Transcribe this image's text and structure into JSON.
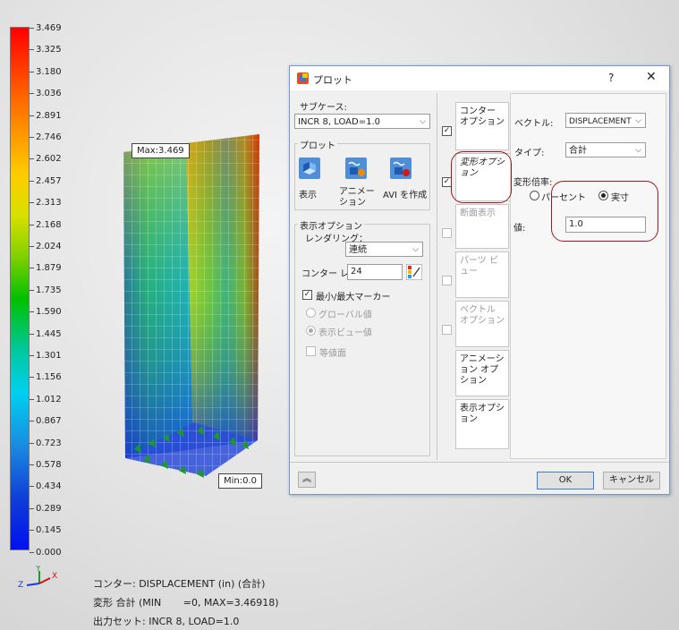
{
  "legend": {
    "values": [
      "3.469",
      "3.325",
      "3.180",
      "3.036",
      "2.891",
      "2.746",
      "2.602",
      "2.457",
      "2.313",
      "2.168",
      "2.024",
      "1.879",
      "1.735",
      "1.590",
      "1.445",
      "1.301",
      "1.156",
      "1.012",
      "0.867",
      "0.723",
      "0.578",
      "0.434",
      "0.289",
      "0.145",
      "0.000"
    ]
  },
  "markers": {
    "max": "Max:3.469",
    "min": "Min:0.0"
  },
  "axis": {
    "z": "Z",
    "y": "Y",
    "x": "X"
  },
  "info": {
    "line1": "コンター: DISPLACEMENT (in) (合計)",
    "line2": "変形 合計 (MIN       =0, MAX=3.46918)",
    "line3": "出力セット: INCR 8, LOAD=1.0"
  },
  "dialog": {
    "title": "プロット",
    "help": "?",
    "close": "✕",
    "subcase_label": "サブケース:",
    "subcase_value": "INCR 8, LOAD=1.0",
    "plot_group": "プロット",
    "tools": [
      {
        "label": "表示",
        "icon": "display-icon"
      },
      {
        "label": "アニメーション",
        "icon": "animation-icon"
      },
      {
        "label": "AVI を作成",
        "icon": "avi-icon"
      }
    ],
    "display_group": "表示オプション",
    "rendering_label": "レンダリング：",
    "rendering_value": "連続",
    "contour_label": "コンター レ",
    "contour_value": "24",
    "minmax_label": "最小/最大マーカー",
    "global_label": "グローバル値",
    "view_label": "表示ビュー値",
    "iso_label": "等値面",
    "tabs": [
      {
        "label": "コンター オプション",
        "checked": true,
        "enabled": true
      },
      {
        "label": "変形オプション",
        "checked": true,
        "enabled": true
      },
      {
        "label": "断面表示",
        "checked": false,
        "enabled": false
      },
      {
        "label": "パーツ ビュー",
        "checked": false,
        "enabled": false
      },
      {
        "label": "ベクトル オプション",
        "checked": false,
        "enabled": false
      },
      {
        "label": "アニメーション オプション",
        "checked": null,
        "enabled": true
      },
      {
        "label": "表示オプション",
        "checked": null,
        "enabled": true
      }
    ],
    "vector_label": "ベクトル:",
    "vector_value": "DISPLACEMENT",
    "type_label": "タイプ:",
    "type_value": "合計",
    "scale_label": "変形倍率:",
    "percent_label": "パーセント",
    "actual_label": "実寸",
    "value_label": "値:",
    "value_value": "1.0",
    "collapse": "︽",
    "ok": "OK",
    "cancel": "キャンセル"
  },
  "colors": {
    "annotation": "#a0181e",
    "accent": "#6f9bd1"
  }
}
